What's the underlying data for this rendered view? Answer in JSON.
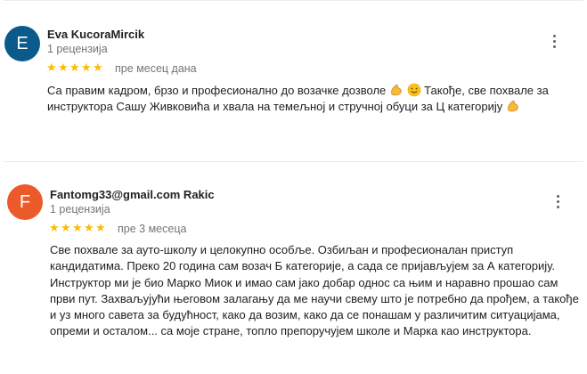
{
  "colors": {
    "avatar_1": "#0b5a8c",
    "avatar_2": "#ec5a2a",
    "star": "#fbbc04",
    "meta": "#70757a"
  },
  "reviews": [
    {
      "initial": "E",
      "name": "Eva KucoraMircik",
      "count": "1 рецензија",
      "rating": 5,
      "date": "пре месец дана",
      "text_part1": "Са правим кадром, брзо и професионално до возачке дозволе",
      "text_part2": "Такође, све похвале за инструктора Сашу Живковића и хвала на темељној и стручној обуци за Ц категорију",
      "emojis": [
        "flexed-biceps-icon",
        "smiling-face-icon",
        "flexed-biceps-icon"
      ]
    },
    {
      "initial": "F",
      "name": "Fantomg33@gmail.com Rakic",
      "count": "1 рецензија",
      "rating": 5,
      "date": "пре 3 месеца",
      "text": "Све похвале за ауто-школу и целокупно особље. Озбиљан и професионалан приступ кандидатима. Преко 20 година сам возач Б категорије, а сада се пријављујем за А категорију. Инструктор ми је био Марко Миок и имао сам јако добар однос са њим и наравно прошао сам први пут. Захваљујући његовом залагању да ме научи свему што је потребно да прођем, а такође и уз много савета за будућност, како да возим, како да се понашам у различитим ситуацијама, опреми и осталом... са моје стране, топло препоручујем школе и Марка као инструктора."
    }
  ]
}
